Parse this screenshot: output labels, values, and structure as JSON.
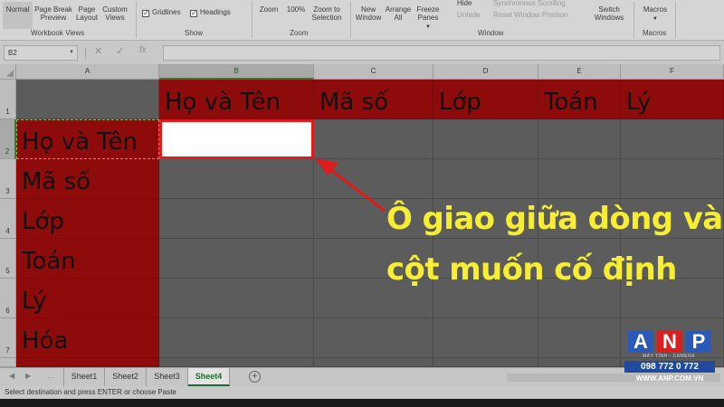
{
  "ribbon": {
    "normal": "Normal",
    "page_break_preview": "Page Break Preview",
    "page_layout": "Page Layout",
    "custom_views": "Custom Views",
    "gridlines": "Gridlines",
    "headings": "Headings",
    "zoom": "Zoom",
    "zoom_100": "100%",
    "zoom_to_selection": "Zoom to Selection",
    "new_window": "New Window",
    "arrange_all": "Arrange All",
    "freeze_panes": "Freeze Panes",
    "hide": "Hide",
    "unhide": "Unhide",
    "synchronous_scrolling": "Synchronous Scrolling",
    "reset_window_position": "Reset Window Position",
    "switch_windows": "Switch Windows",
    "macros": "Macros",
    "groups": {
      "workbook_views": "Workbook Views",
      "show": "Show",
      "zoom": "Zoom",
      "window": "Window",
      "macros": "Macros"
    }
  },
  "formula_bar": {
    "name_box": "B2",
    "fx": "fx",
    "value": ""
  },
  "grid": {
    "columns": [
      "A",
      "B",
      "C",
      "D",
      "E",
      "F"
    ],
    "rows": [
      "1",
      "2",
      "3",
      "4",
      "5",
      "6",
      "7"
    ],
    "row1": [
      "",
      "Họ và Tên",
      "Mã số",
      "Lớp",
      "Toán",
      "Lý"
    ],
    "colA": [
      "",
      "Họ và Tên",
      "Mã số",
      "Lớp",
      "Toán",
      "Lý",
      "Hóa"
    ],
    "active_cell": "B2",
    "fill_color": "#8e0b0b"
  },
  "annotation": {
    "line1": "Ô giao giữa dòng và",
    "line2": "cột muốn cố định",
    "color": "#f7ee33"
  },
  "sheet_tabs": [
    "Sheet1",
    "Sheet2",
    "Sheet3",
    "Sheet4"
  ],
  "active_sheet": "Sheet4",
  "status_bar": "Select destination and press ENTER or choose Paste",
  "logo": {
    "letters": [
      "A",
      "N",
      "P"
    ],
    "tagline": "MÁY TÍNH - CAMERA",
    "phone": "098 772 0 772",
    "website": "WWW.ANP.COM.VN"
  }
}
